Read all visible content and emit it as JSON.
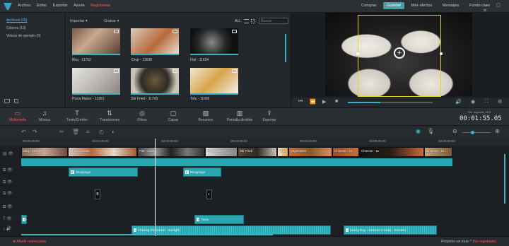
{
  "menu": [
    {
      "label": "Archivo"
    },
    {
      "label": "Editar"
    },
    {
      "label": "Exportar"
    },
    {
      "label": "Ayuda"
    },
    {
      "label": "Registrarse",
      "accent": true
    }
  ],
  "topright": {
    "buttons": [
      "Comprar",
      "Guardar",
      "Más efectos",
      "Mensajes",
      "Fondo claro"
    ],
    "active": "Guardar"
  },
  "left_panel": {
    "categories": [
      "Archivos (26)",
      "Colores (13)",
      "Videos de ejemplo (9)"
    ]
  },
  "media": {
    "import_label": "Importar",
    "record_label": "Grabar",
    "all_label": "ALL",
    "search_placeholder": "Buscar",
    "items": [
      {
        "label": "Bbq - 11702"
      },
      {
        "label": "Chop - 11638"
      },
      {
        "label": "Flat - 11634"
      },
      {
        "label": "Pizza Maker - 11991"
      },
      {
        "label": "Stir Fried - 11703"
      },
      {
        "label": "Tofu - 11665"
      }
    ]
  },
  "toolbar": {
    "items": [
      "Multimedia",
      "Música",
      "Texto/Crédito",
      "Transiciones",
      "Filtros",
      "Capas",
      "Recursos",
      "Pantalla dividida",
      "Exportar"
    ],
    "selected": "Multimedia",
    "aspect_label": "Rel. aspecto: 16:9",
    "timecode": "00:01:55.05"
  },
  "ruler": {
    "ticks": [
      "00:00:00:00",
      "00:01:00:00",
      "00:02:00:00",
      "00:03:00:00",
      "00:04:00:00",
      "00:05:00:00",
      "00:06:00:00"
    ]
  },
  "timeline": {
    "video_clips": [
      "Bbq - 11702",
      "Chop - 11638",
      "Flat - 11634",
      "Pizza Make",
      "Stir Fried",
      "Tofu",
      "Vegetables",
      "Chinese - 11",
      "Chinese - 11",
      "Chinese - 11"
    ],
    "overlay_clips": [
      "Shopping4",
      "Shopping4"
    ],
    "text_clips": [
      "Texto"
    ],
    "audio_clips": [
      "Chasing the sunset - Sunlight",
      "Sunny Day - Summer's Grain - Summer"
    ]
  },
  "status": {
    "add_track": "Añadir nueva pista",
    "project": "Proyecto sin título *",
    "unregistered": "(No registrado)"
  },
  "colors": {
    "accent": "#4a9ea8",
    "red": "#ff5a5a",
    "teal_track": "#2aa6b1"
  }
}
